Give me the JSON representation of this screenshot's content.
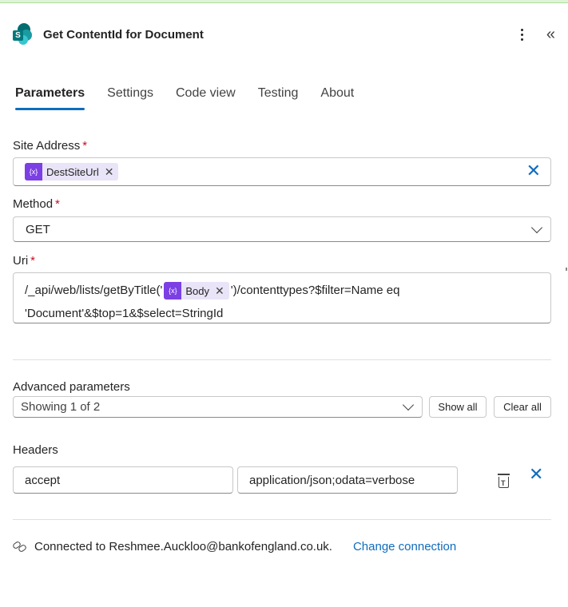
{
  "header": {
    "title": "Get ContentId for Document",
    "logo_glyph": "S",
    "more_icon": "more-vertical-icon",
    "collapse_glyph": "«"
  },
  "tabs": [
    {
      "label": "Parameters",
      "active": true
    },
    {
      "label": "Settings",
      "active": false
    },
    {
      "label": "Code view",
      "active": false
    },
    {
      "label": "Testing",
      "active": false
    },
    {
      "label": "About",
      "active": false
    }
  ],
  "site_address": {
    "label": "Site Address",
    "required_mark": "*",
    "token_icon": "{x}",
    "token_label": "DestSiteUrl",
    "token_remove": "✕",
    "clear_glyph": "✕"
  },
  "method": {
    "label": "Method",
    "required_mark": "*",
    "value": "GET"
  },
  "uri": {
    "label": "Uri",
    "required_mark": "*",
    "text_before": "/_api/web/lists/getByTitle('",
    "token_icon": "{x}",
    "token_label": "Body",
    "token_remove": "✕",
    "text_after": "')/contenttypes?$filter=Name eq",
    "text_line2": "'Document'&$top=1&$select=StringId"
  },
  "advanced": {
    "label": "Advanced parameters",
    "select_value": "Showing 1 of 2",
    "show_all": "Show all",
    "clear_all": "Clear all"
  },
  "headers": {
    "label": "Headers",
    "key": "accept",
    "value": "application/json;odata=verbose",
    "delete_glyph": "✕",
    "trash_glyph": "T"
  },
  "connection": {
    "text": "Connected to Reshmee.Auckloo@bankofengland.co.uk.",
    "link": "Change connection"
  },
  "colors": {
    "accent": "#0f6cbd",
    "token_bg": "#e9e4f7",
    "token_icon_bg": "#7b3fe4",
    "required": "#c50f1f"
  }
}
